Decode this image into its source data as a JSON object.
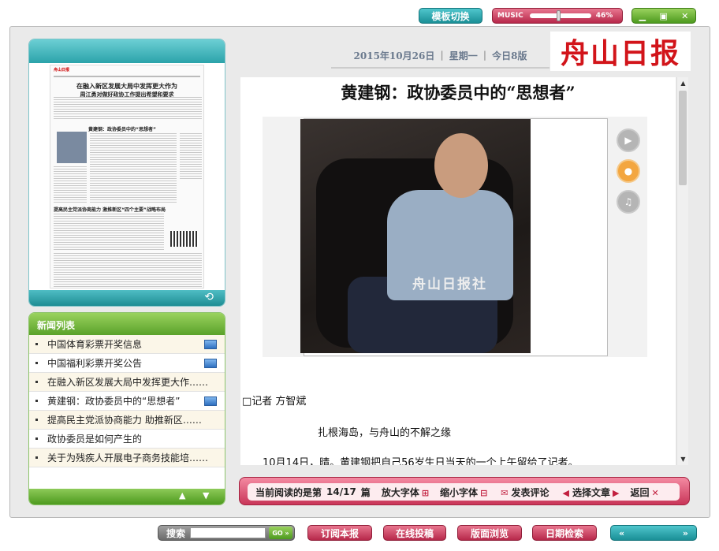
{
  "top": {
    "template_switch": "模板切换",
    "music_label": "MUSIC",
    "music_volume": "46%",
    "music_level": 0.46
  },
  "header": {
    "date": "2015年10月26日",
    "weekday": "星期一",
    "edition": "今日8版",
    "masthead": "舟山日报"
  },
  "article": {
    "title": "黄建钢：政协委员中的“思想者”",
    "photo_watermark": "舟山日报社",
    "byline": "□记者  方智斌",
    "subhead": "扎根海岛，与舟山的不解之缘",
    "first_para": "10月14日，晴。黄建钢把自己56岁生日当天的一个上午留给了记者。"
  },
  "news": {
    "heading": "新闻列表",
    "items": [
      {
        "label": "中国体育彩票开奖信息",
        "has_image": true
      },
      {
        "label": "中国福利彩票开奖公告",
        "has_image": true
      },
      {
        "label": "在融入新区发展大局中发挥更大作……",
        "has_image": false
      },
      {
        "label": "黄建钢：政协委员中的“思想者”",
        "has_image": true
      },
      {
        "label": "提高民主党派协商能力 助推新区……",
        "has_image": false
      },
      {
        "label": "政协委员是如何产生的",
        "has_image": false
      },
      {
        "label": "关于为残疾人开展电子商务技能培……",
        "has_image": false
      }
    ]
  },
  "status": {
    "reading_prefix": "当前阅读的是第",
    "reading_count": "14/17",
    "reading_suffix": "篇",
    "enlarge": "放大字体",
    "shrink": "缩小字体",
    "comment": "发表评论",
    "select": "选择文章",
    "back": "返回"
  },
  "bottom": {
    "search_label": "搜索",
    "go": "GO",
    "subscribe": "订阅本报",
    "submit": "在线投稿",
    "browse": "版面浏览",
    "date_search": "日期检索"
  },
  "thumb": {
    "headline1": "在融入新区发展大局中发挥更大作为",
    "headline2": "周江勇对做好政协工作提出希望和要求",
    "headline3": "黄建钢：政协委员中的“思想者”",
    "headline4": "提高民主党派协商能力 激推新区“四个主要”战略布局"
  },
  "colors": {
    "teal": "#1a8f96",
    "pink": "#b7284a",
    "green": "#4d9a1e",
    "masthead_red": "#d2141a"
  }
}
